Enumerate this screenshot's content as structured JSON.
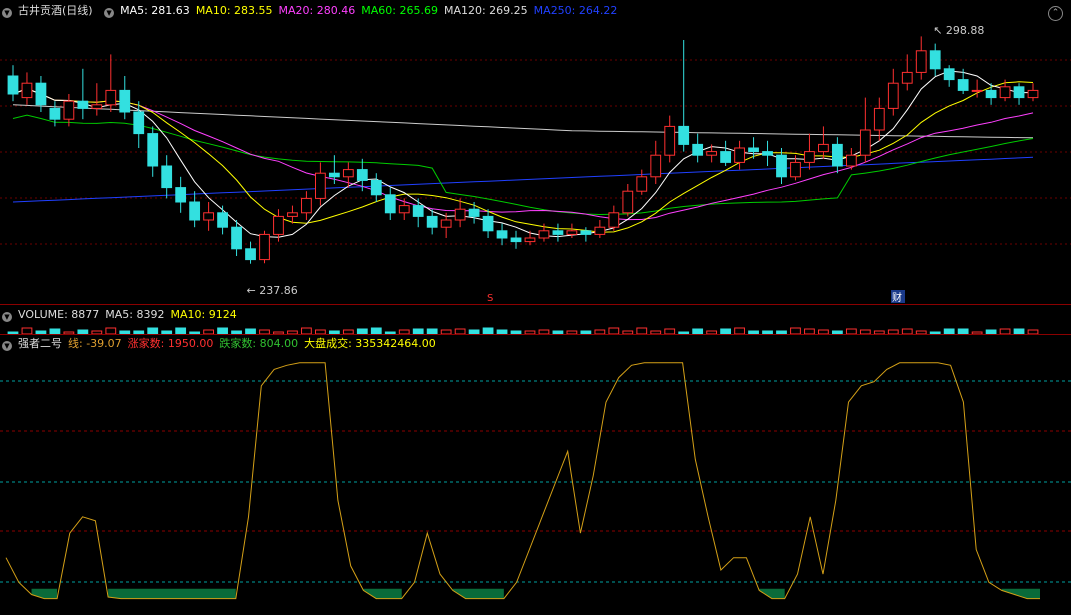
{
  "price_header": {
    "title": "古井贡酒(日线)",
    "ma": [
      {
        "label": "MA5: 281.63",
        "color": "#ffffff"
      },
      {
        "label": "MA10: 283.55",
        "color": "#ffff00"
      },
      {
        "label": "MA20: 280.46",
        "color": "#ff40ff"
      },
      {
        "label": "MA60: 265.69",
        "color": "#00ff00"
      },
      {
        "label": "MA120: 269.25",
        "color": "#dddddd"
      },
      {
        "label": "MA250: 264.22",
        "color": "#2040ff"
      }
    ]
  },
  "annotations": {
    "high": "298.88",
    "low": "237.86",
    "marker_s": "S",
    "marker_cai": "财"
  },
  "volume_header": [
    {
      "label": "VOLUME: 8877",
      "color": "#dddddd"
    },
    {
      "label": "MA5: 8392",
      "color": "#dddddd"
    },
    {
      "label": "MA10: 9124",
      "color": "#ffff00"
    }
  ],
  "indicator_header": [
    {
      "label": "强者二号",
      "color": "#dddddd"
    },
    {
      "label": "线: -39.07",
      "color": "#e0a030"
    },
    {
      "label": "涨家数: 1950.00",
      "color": "#ff3030"
    },
    {
      "label": "跌家数: 804.00",
      "color": "#30c030"
    },
    {
      "label": "大盘成交: 335342464.00",
      "color": "#ffff00"
    }
  ],
  "colors": {
    "up": "#ff3030",
    "down": "#33e0e0",
    "grid": "#6b0000",
    "indicator_line": "#d4a017",
    "indicator_fill": "#0a6b3a"
  },
  "chart_data": {
    "type": "candlestick",
    "price_ylim": [
      230,
      305
    ],
    "candles": [
      [
        290,
        285,
        293,
        283
      ],
      [
        284,
        288,
        291,
        282
      ],
      [
        288,
        282,
        290,
        280
      ],
      [
        281,
        278,
        283,
        276
      ],
      [
        278,
        283,
        285,
        276
      ],
      [
        283,
        281,
        292,
        278
      ],
      [
        281,
        282,
        288,
        279
      ],
      [
        282,
        286,
        296,
        280
      ],
      [
        286,
        280,
        290,
        278
      ],
      [
        280,
        274,
        283,
        270
      ],
      [
        274,
        265,
        276,
        262
      ],
      [
        265,
        259,
        268,
        256
      ],
      [
        259,
        255,
        262,
        252
      ],
      [
        255,
        250,
        258,
        248
      ],
      [
        250,
        252,
        255,
        247
      ],
      [
        252,
        248,
        254,
        246
      ],
      [
        248,
        242,
        250,
        240
      ],
      [
        242,
        239,
        244,
        237.86
      ],
      [
        239,
        246,
        247,
        238
      ],
      [
        246,
        251,
        253,
        244
      ],
      [
        251,
        252,
        254,
        249
      ],
      [
        252,
        256,
        258,
        250
      ],
      [
        256,
        263,
        266,
        254
      ],
      [
        263,
        262,
        268,
        260
      ],
      [
        262,
        264,
        266,
        259
      ],
      [
        264,
        261,
        267,
        258
      ],
      [
        261,
        257,
        263,
        255
      ],
      [
        257,
        252,
        259,
        250
      ],
      [
        252,
        254,
        256,
        250
      ],
      [
        254,
        251,
        256,
        248
      ],
      [
        251,
        248,
        253,
        246
      ],
      [
        248,
        250,
        252,
        245
      ],
      [
        250,
        253,
        256,
        248
      ],
      [
        253,
        251,
        255,
        249
      ],
      [
        251,
        247,
        253,
        245
      ],
      [
        247,
        245,
        249,
        243
      ],
      [
        245,
        244,
        247,
        242
      ],
      [
        244,
        245,
        247,
        243
      ],
      [
        245,
        247,
        249,
        244
      ],
      [
        247,
        246,
        249,
        244
      ],
      [
        246,
        247,
        249,
        245
      ],
      [
        247,
        246,
        248,
        244
      ],
      [
        246,
        248,
        250,
        245
      ],
      [
        248,
        252,
        254,
        247
      ],
      [
        252,
        258,
        260,
        251
      ],
      [
        258,
        262,
        264,
        257
      ],
      [
        262,
        268,
        272,
        260
      ],
      [
        268,
        276,
        279,
        266
      ],
      [
        276,
        271,
        300,
        269
      ],
      [
        271,
        268,
        274,
        266
      ],
      [
        268,
        269,
        271,
        266
      ],
      [
        269,
        266,
        272,
        265
      ],
      [
        266,
        270,
        272,
        264
      ],
      [
        270,
        269,
        273,
        267
      ],
      [
        269,
        268,
        272,
        265
      ],
      [
        268,
        262,
        270,
        260
      ],
      [
        262,
        266,
        268,
        261
      ],
      [
        266,
        269,
        274,
        264
      ],
      [
        269,
        271,
        276,
        267
      ],
      [
        271,
        265,
        273,
        263
      ],
      [
        265,
        268,
        270,
        264
      ],
      [
        268,
        275,
        284,
        266
      ],
      [
        275,
        281,
        284,
        272
      ],
      [
        281,
        288,
        292,
        279
      ],
      [
        288,
        291,
        296,
        286
      ],
      [
        291,
        297,
        301,
        289
      ],
      [
        297,
        292,
        299,
        290
      ],
      [
        292,
        289,
        293,
        287
      ],
      [
        289,
        286,
        292,
        285
      ],
      [
        286,
        286,
        289,
        284
      ],
      [
        286,
        284,
        288,
        282
      ],
      [
        284,
        287,
        289,
        283
      ],
      [
        287,
        284,
        288,
        282
      ],
      [
        284,
        286,
        288,
        283
      ]
    ],
    "indicator_ylim": [
      -60,
      260
    ],
    "indicator_line": [
      10,
      -20,
      -35,
      -40,
      -40,
      40,
      60,
      55,
      -38,
      -40,
      -40,
      -40,
      -40,
      -40,
      -40,
      -40,
      -40,
      -40,
      -40,
      60,
      220,
      240,
      245,
      248,
      248,
      248,
      80,
      0,
      -30,
      -40,
      -40,
      -40,
      -20,
      40,
      -10,
      -30,
      -40,
      -40,
      -40,
      -40,
      -20,
      20,
      60,
      100,
      140,
      40,
      110,
      200,
      230,
      245,
      248,
      248,
      248,
      248,
      130,
      60,
      -5,
      10,
      10,
      -30,
      -40,
      -40,
      -10,
      60,
      -10,
      80,
      200,
      220,
      225,
      240,
      248,
      248,
      248,
      248,
      245,
      200,
      20,
      -20,
      -30,
      -35,
      -40,
      -40
    ]
  }
}
